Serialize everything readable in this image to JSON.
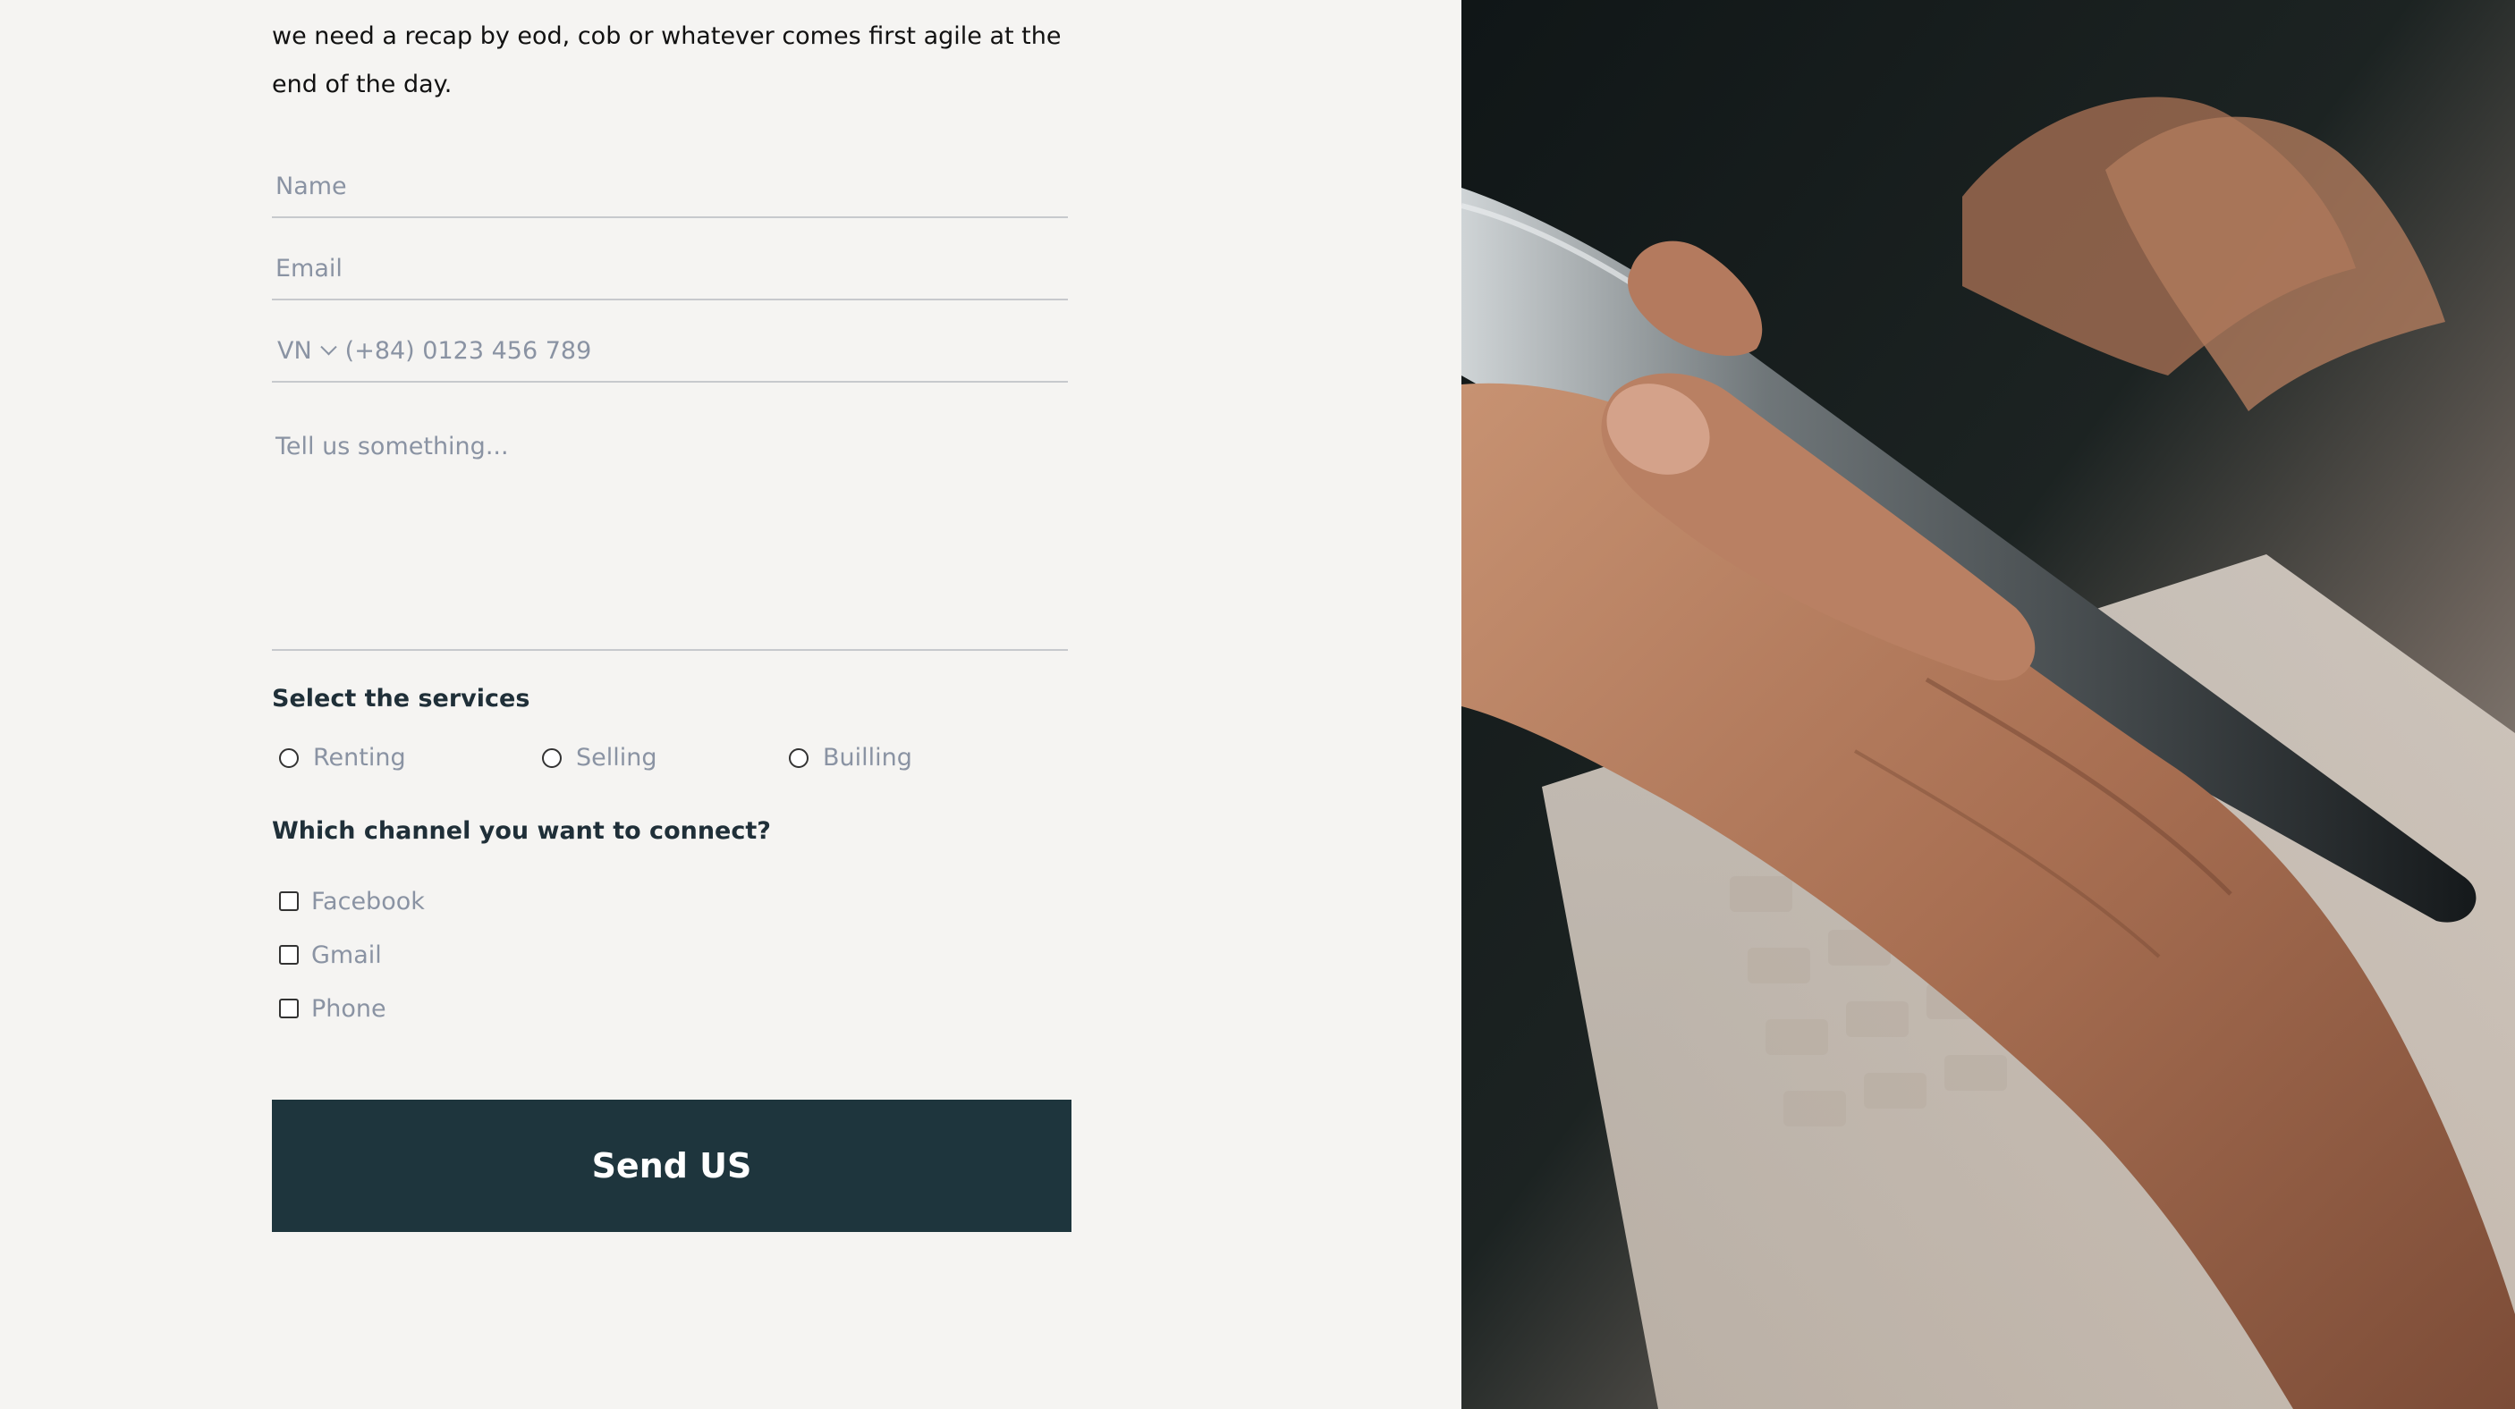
{
  "intro_text": "we need a recap by eod, cob or whatever comes first agile at the end of the day.",
  "form": {
    "name_placeholder": "Name",
    "email_placeholder": "Email",
    "phone": {
      "country_code": "VN",
      "placeholder": "(+84) 0123 456 789"
    },
    "message_placeholder": "Tell us something..."
  },
  "services": {
    "label": "Select the services",
    "options": [
      "Renting",
      "Selling",
      "Builling"
    ]
  },
  "channels": {
    "label": "Which channel you want to connect?",
    "options": [
      "Facebook",
      "Gmail",
      "Phone"
    ]
  },
  "submit_label": "Send US",
  "colors": {
    "page_bg": "#f5f4f2",
    "button_bg": "#1e353d",
    "placeholder": "#8a93a3",
    "heading": "#1f2f38"
  },
  "image": {
    "icon": "hand-holding-smartphone-photo"
  }
}
